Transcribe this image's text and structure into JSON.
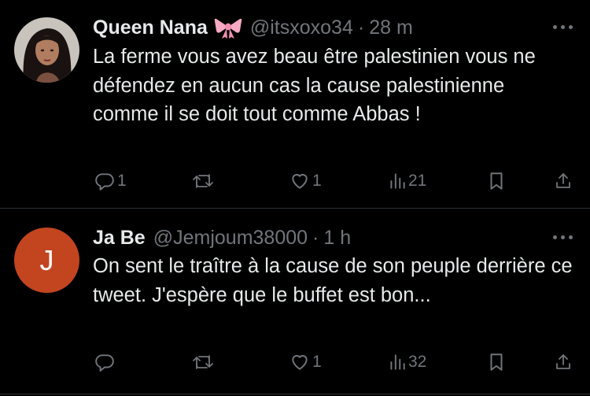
{
  "tweets": [
    {
      "name": "Queen Nana",
      "name_emoji": "🎀",
      "handle": "@itsxoxo34",
      "separator": "·",
      "time": "28 m",
      "text": "La ferme vous avez beau être palestinien vous ne défendez en aucun cas la cause palestinienne comme il se doit tout comme Abbas !",
      "replies": "1",
      "retweets": "",
      "likes": "1",
      "views": "21"
    },
    {
      "avatar_letter": "J",
      "name": "Ja Be",
      "handle": "@Jemjoum38000",
      "separator": "·",
      "time": "1 h",
      "text": "On sent le traître à la cause de son peuple derrière ce tweet. J'espère que le buffet est bon...",
      "replies": "",
      "retweets": "",
      "likes": "1",
      "views": "32"
    }
  ],
  "colors": {
    "background": "#000000",
    "text": "#e7e9ea",
    "muted": "#71767b",
    "avatar_j": "#c2451f",
    "divider": "#2f3336"
  }
}
